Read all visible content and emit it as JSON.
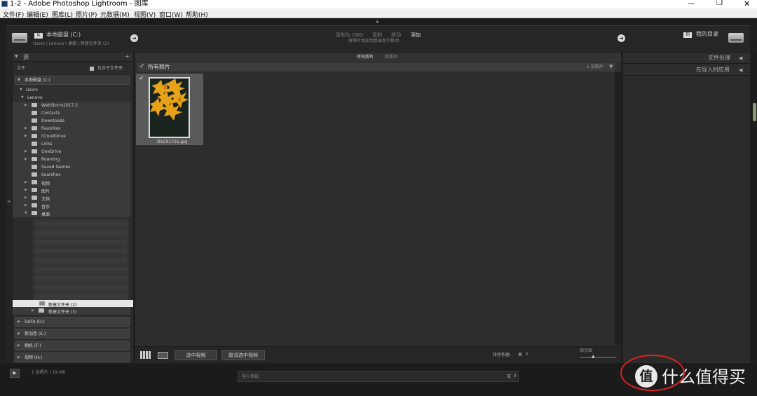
{
  "window": {
    "title": "1-2 - Adobe Photoshop Lightroom - 图库"
  },
  "menu": [
    "文件(F)",
    "编辑(E)",
    "图库(L)",
    "照片(P)",
    "元数据(M)",
    "视图(V)",
    "窗口(W)",
    "帮助(H)"
  ],
  "header": {
    "source_drive": "本地磁盘 (C:)",
    "source_path": "Users \\ Lenovo \\ 桌面 \\ 新建文件夹 (2)",
    "modes": [
      "复制为 DNG",
      "复制",
      "移动",
      "添加"
    ],
    "active_mode": "添加",
    "mode_desc": "将照片添加到目录而不移动",
    "dest": "我的目录"
  },
  "left_panel": {
    "title": "源",
    "files_label": "文件",
    "include_sub": "包含子文件夹",
    "drive_top": "本地磁盘 (C:)",
    "users": "Users",
    "lenovo": "Lenovo",
    "folders": [
      "WebStorm2017.2",
      "Contacts",
      "Downloads",
      "Favorites",
      "iCloudDrive",
      "Links",
      "OneDrive",
      "Roaming",
      "Saved Games",
      "Searches",
      "视频",
      "图片",
      "文档",
      "音乐",
      "桌面"
    ],
    "selected_folder": "新建文件夹 (2)",
    "next_folder": "新建文件夹 (3)",
    "drives": [
      "DATA (D:)",
      "新加卷 (E:)",
      "相机 (F:)",
      "视频 (H:)"
    ]
  },
  "center": {
    "tabs": [
      "所有照片",
      "新照片"
    ],
    "group_label": "所有照片",
    "group_count": "1 张照片",
    "photo_name": "DSC01755.jpg",
    "btn_select_all": "选中视频",
    "btn_deselect": "取消选中视频",
    "sort_label": "排序依据:",
    "sort_value": "关",
    "thumb_label": "缩览图"
  },
  "right_panel": {
    "file_handling": "文件处理",
    "apply_during_import": "在导入时应用"
  },
  "status": {
    "info": "1 张照片 / 19 MB",
    "preset_label": "导入预设:",
    "preset_value": "无"
  },
  "watermark": {
    "text": "什么值得买",
    "badge": "值"
  }
}
